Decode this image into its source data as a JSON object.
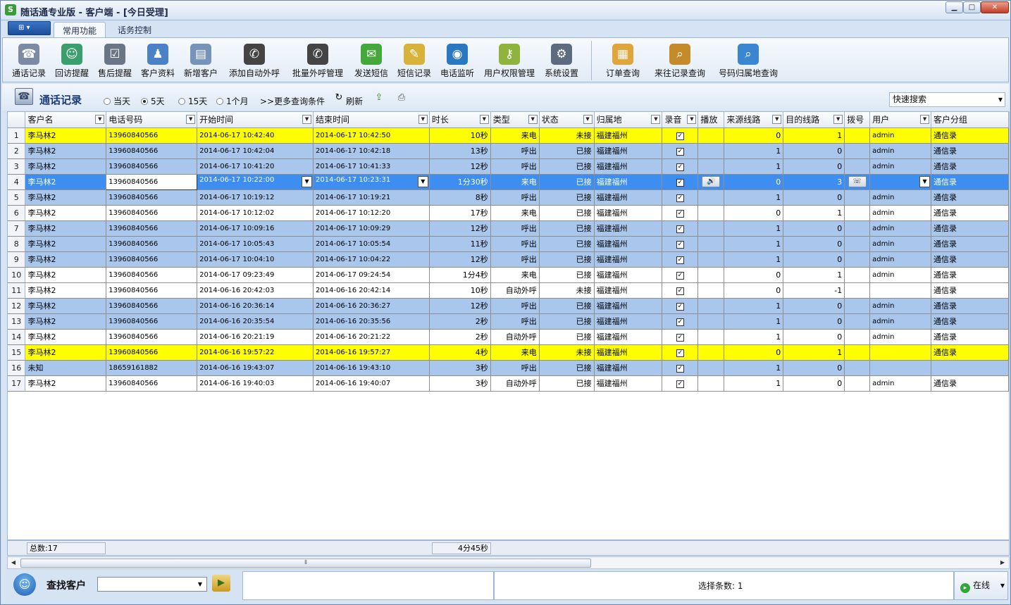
{
  "window": {
    "title": "随话通专业版 - 客户端 - [今日受理]",
    "app_menu_icon": "grid-icon"
  },
  "ribbon_tabs": [
    "常用功能",
    "话务控制"
  ],
  "ribbon": [
    {
      "label": "通话记录",
      "icon": "phone-log-icon",
      "color": "#7b8ba3"
    },
    {
      "label": "回访提醒",
      "icon": "person-callback-icon",
      "color": "#3b9e6d"
    },
    {
      "label": "售后提醒",
      "icon": "checklist-icon",
      "color": "#6a7585"
    },
    {
      "label": "客户资料",
      "icon": "customer-icon",
      "color": "#4a82c5"
    },
    {
      "label": "新增客户",
      "icon": "id-card-icon",
      "color": "#7794b8"
    },
    {
      "label": "添加自动外呼",
      "icon": "phone-add-icon",
      "color": "#444444"
    },
    {
      "label": "批量外呼管理",
      "icon": "phone-batch-icon",
      "color": "#444444"
    },
    {
      "label": "发送短信",
      "icon": "sms-bubble-icon",
      "color": "#45a83b"
    },
    {
      "label": "短信记录",
      "icon": "sms-log-icon",
      "color": "#d9b23a"
    },
    {
      "label": "电话监听",
      "icon": "monitor-icon",
      "color": "#2a78c0"
    },
    {
      "label": "用户权限管理",
      "icon": "key-icon",
      "color": "#8fb33c"
    },
    {
      "label": "系统设置",
      "icon": "settings-icon",
      "color": "#5d6b7f"
    },
    {
      "label": "订单查询",
      "icon": "order-icon",
      "color": "#e0a63b"
    },
    {
      "label": "来往记录查询",
      "icon": "history-search-icon",
      "color": "#c58a2a"
    },
    {
      "label": "号码归属地查询",
      "icon": "magnifier-icon",
      "color": "#3b86d1"
    }
  ],
  "filter": {
    "title": "通话记录",
    "options": [
      "当天",
      "5天",
      "15天",
      "1个月"
    ],
    "selected": "5天",
    "more": ">>更多查询条件",
    "refresh": "刷新",
    "quick_search": "快速搜索"
  },
  "grid": {
    "columns": [
      "客户名",
      "电话号码",
      "开始时间",
      "结束时间",
      "时长",
      "类型",
      "状态",
      "归属地",
      "录音",
      "播放",
      "来源线路",
      "目的线路",
      "拨号",
      "用户",
      "客户分组"
    ],
    "rows": [
      {
        "n": "1",
        "name": "李马林2",
        "phone": "13960840566",
        "start": "2014-06-17 10:42:40",
        "end": "2014-06-17 10:42:50",
        "dur": "10秒",
        "type": "来电",
        "status": "未接",
        "loc": "福建福州",
        "rec": true,
        "src": "0",
        "dst": "1",
        "user": "admin",
        "group": "通信录",
        "style": "yel"
      },
      {
        "n": "2",
        "name": "李马林2",
        "phone": "13960840566",
        "start": "2014-06-17 10:42:04",
        "end": "2014-06-17 10:42:18",
        "dur": "13秒",
        "type": "呼出",
        "status": "已接",
        "loc": "福建福州",
        "rec": true,
        "src": "1",
        "dst": "0",
        "user": "admin",
        "group": "通信录",
        "style": "alt"
      },
      {
        "n": "3",
        "name": "李马林2",
        "phone": "13960840566",
        "start": "2014-06-17 10:41:20",
        "end": "2014-06-17 10:41:33",
        "dur": "12秒",
        "type": "呼出",
        "status": "已接",
        "loc": "福建福州",
        "rec": true,
        "src": "1",
        "dst": "0",
        "user": "admin",
        "group": "通信录",
        "style": "alt"
      },
      {
        "n": "4",
        "name": "李马林2",
        "phone": "13960840566",
        "start": "2014-06-17 10:22:00",
        "end": "2014-06-17 10:23:31",
        "dur": "1分30秒",
        "type": "来电",
        "status": "已接",
        "loc": "福建福州",
        "rec": true,
        "src": "0",
        "dst": "3",
        "user": "",
        "group": "通信录",
        "style": "sel"
      },
      {
        "n": "5",
        "name": "李马林2",
        "phone": "13960840566",
        "start": "2014-06-17 10:19:12",
        "end": "2014-06-17 10:19:21",
        "dur": "8秒",
        "type": "呼出",
        "status": "已接",
        "loc": "福建福州",
        "rec": true,
        "src": "1",
        "dst": "0",
        "user": "admin",
        "group": "通信录",
        "style": "alt"
      },
      {
        "n": "6",
        "name": "李马林2",
        "phone": "13960840566",
        "start": "2014-06-17 10:12:02",
        "end": "2014-06-17 10:12:20",
        "dur": "17秒",
        "type": "来电",
        "status": "已接",
        "loc": "福建福州",
        "rec": true,
        "src": "0",
        "dst": "1",
        "user": "admin",
        "group": "通信录",
        "style": "wht"
      },
      {
        "n": "7",
        "name": "李马林2",
        "phone": "13960840566",
        "start": "2014-06-17 10:09:16",
        "end": "2014-06-17 10:09:29",
        "dur": "12秒",
        "type": "呼出",
        "status": "已接",
        "loc": "福建福州",
        "rec": true,
        "src": "1",
        "dst": "0",
        "user": "admin",
        "group": "通信录",
        "style": "alt"
      },
      {
        "n": "8",
        "name": "李马林2",
        "phone": "13960840566",
        "start": "2014-06-17 10:05:43",
        "end": "2014-06-17 10:05:54",
        "dur": "11秒",
        "type": "呼出",
        "status": "已接",
        "loc": "福建福州",
        "rec": true,
        "src": "1",
        "dst": "0",
        "user": "admin",
        "group": "通信录",
        "style": "alt"
      },
      {
        "n": "9",
        "name": "李马林2",
        "phone": "13960840566",
        "start": "2014-06-17 10:04:10",
        "end": "2014-06-17 10:04:22",
        "dur": "12秒",
        "type": "呼出",
        "status": "已接",
        "loc": "福建福州",
        "rec": true,
        "src": "1",
        "dst": "0",
        "user": "admin",
        "group": "通信录",
        "style": "alt"
      },
      {
        "n": "10",
        "name": "李马林2",
        "phone": "13960840566",
        "start": "2014-06-17 09:23:49",
        "end": "2014-06-17 09:24:54",
        "dur": "1分4秒",
        "type": "来电",
        "status": "已接",
        "loc": "福建福州",
        "rec": true,
        "src": "0",
        "dst": "1",
        "user": "admin",
        "group": "通信录",
        "style": "wht"
      },
      {
        "n": "11",
        "name": "李马林2",
        "phone": "13960840566",
        "start": "2014-06-16 20:42:03",
        "end": "2014-06-16 20:42:14",
        "dur": "10秒",
        "type": "自动外呼",
        "status": "未接",
        "loc": "福建福州",
        "rec": true,
        "src": "0",
        "dst": "-1",
        "user": "",
        "group": "通信录",
        "style": "wht"
      },
      {
        "n": "12",
        "name": "李马林2",
        "phone": "13960840566",
        "start": "2014-06-16 20:36:14",
        "end": "2014-06-16 20:36:27",
        "dur": "12秒",
        "type": "呼出",
        "status": "已接",
        "loc": "福建福州",
        "rec": true,
        "src": "1",
        "dst": "0",
        "user": "admin",
        "group": "通信录",
        "style": "alt"
      },
      {
        "n": "13",
        "name": "李马林2",
        "phone": "13960840566",
        "start": "2014-06-16 20:35:54",
        "end": "2014-06-16 20:35:56",
        "dur": "2秒",
        "type": "呼出",
        "status": "已接",
        "loc": "福建福州",
        "rec": true,
        "src": "1",
        "dst": "0",
        "user": "admin",
        "group": "通信录",
        "style": "alt"
      },
      {
        "n": "14",
        "name": "李马林2",
        "phone": "13960840566",
        "start": "2014-06-16 20:21:19",
        "end": "2014-06-16 20:21:22",
        "dur": "2秒",
        "type": "自动外呼",
        "status": "已接",
        "loc": "福建福州",
        "rec": true,
        "src": "1",
        "dst": "0",
        "user": "admin",
        "group": "通信录",
        "style": "wht"
      },
      {
        "n": "15",
        "name": "李马林2",
        "phone": "13960840566",
        "start": "2014-06-16 19:57:22",
        "end": "2014-06-16 19:57:27",
        "dur": "4秒",
        "type": "来电",
        "status": "未接",
        "loc": "福建福州",
        "rec": true,
        "src": "0",
        "dst": "1",
        "user": "",
        "group": "通信录",
        "style": "yel"
      },
      {
        "n": "16",
        "name": "未知",
        "phone": "18659161882",
        "start": "2014-06-16 19:43:07",
        "end": "2014-06-16 19:43:10",
        "dur": "3秒",
        "type": "呼出",
        "status": "已接",
        "loc": "福建福州",
        "rec": true,
        "src": "1",
        "dst": "0",
        "user": "",
        "group": "",
        "style": "alt"
      },
      {
        "n": "17",
        "name": "李马林2",
        "phone": "13960840566",
        "start": "2014-06-16 19:40:03",
        "end": "2014-06-16 19:40:07",
        "dur": "3秒",
        "type": "自动外呼",
        "status": "已接",
        "loc": "福建福州",
        "rec": true,
        "src": "1",
        "dst": "0",
        "user": "admin",
        "group": "通信录",
        "style": "wht"
      }
    ]
  },
  "summary": {
    "count": "总数:17",
    "total_duration": "4分45秒"
  },
  "bottom": {
    "find_label": "查找客户",
    "find_value": "",
    "selected_count": "选择条数: 1",
    "status": "在线"
  }
}
